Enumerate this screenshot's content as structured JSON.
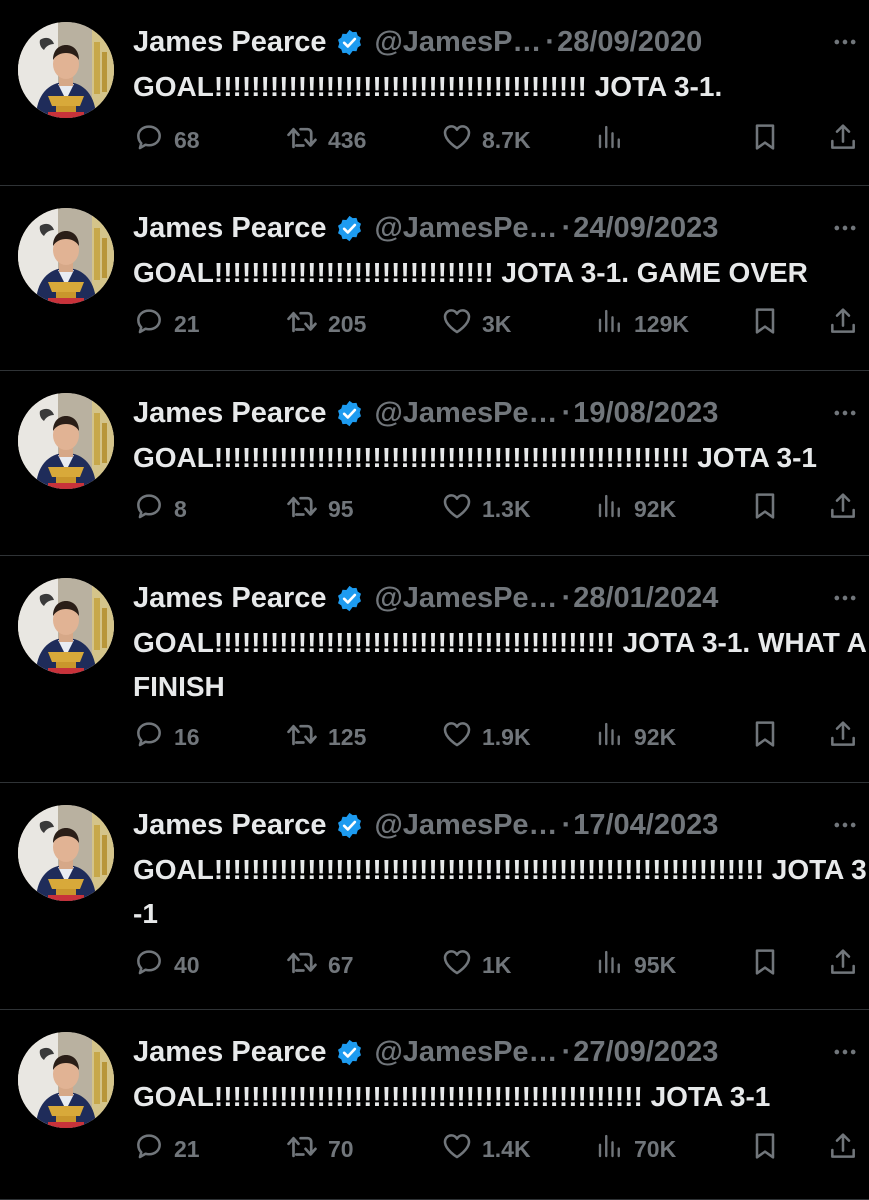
{
  "tweets": [
    {
      "name": "James Pearce",
      "handle": "@JamesP…",
      "separator": "·",
      "date": "28/09/2020",
      "text": "GOAL!!!!!!!!!!!!!!!!!!!!!!!!!!!!!!!!!!!!!!!! JOTA 3-1.",
      "replies": "68",
      "retweets": "436",
      "likes": "8.7K",
      "views": ""
    },
    {
      "name": "James Pearce",
      "handle": "@JamesPe…",
      "separator": "·",
      "date": "24/09/2023",
      "text": "GOAL!!!!!!!!!!!!!!!!!!!!!!!!!!!!!! JOTA 3-1. GAME OVER",
      "replies": "21",
      "retweets": "205",
      "likes": "3K",
      "views": "129K"
    },
    {
      "name": "James Pearce",
      "handle": "@JamesPe…",
      "separator": "·",
      "date": "19/08/2023",
      "text": "GOAL!!!!!!!!!!!!!!!!!!!!!!!!!!!!!!!!!!!!!!!!!!!!!!!!!!! JOTA 3-1",
      "replies": "8",
      "retweets": "95",
      "likes": "1.3K",
      "views": "92K"
    },
    {
      "name": "James Pearce",
      "handle": "@JamesPe…",
      "separator": "·",
      "date": "28/01/2024",
      "text": "GOAL!!!!!!!!!!!!!!!!!!!!!!!!!!!!!!!!!!!!!!!!!!! JOTA 3-1. WHAT A FINISH",
      "replies": "16",
      "retweets": "125",
      "likes": "1.9K",
      "views": "92K"
    },
    {
      "name": "James Pearce",
      "handle": "@JamesPe…",
      "separator": "·",
      "date": "17/04/2023",
      "text": "GOAL!!!!!!!!!!!!!!!!!!!!!!!!!!!!!!!!!!!!!!!!!!!!!!!!!!!!!!!!!!! JOTA 3-1",
      "replies": "40",
      "retweets": "67",
      "likes": "1K",
      "views": "95K"
    },
    {
      "name": "James Pearce",
      "handle": "@JamesPe…",
      "separator": "·",
      "date": "27/09/2023",
      "text": "GOAL!!!!!!!!!!!!!!!!!!!!!!!!!!!!!!!!!!!!!!!!!!!!!! JOTA 3-1",
      "replies": "21",
      "retweets": "70",
      "likes": "1.4K",
      "views": "70K"
    }
  ],
  "icons": {
    "reply": "reply-icon",
    "retweet": "retweet-icon",
    "like": "heart-icon",
    "views": "views-icon",
    "bookmark": "bookmark-icon",
    "share": "share-icon",
    "more": "more-icon",
    "verified": "verified-badge-icon"
  },
  "colors": {
    "background": "#000000",
    "text": "#e7e9ea",
    "secondary": "#71767b",
    "verified": "#1d9bf0",
    "divider": "#2f3336"
  }
}
